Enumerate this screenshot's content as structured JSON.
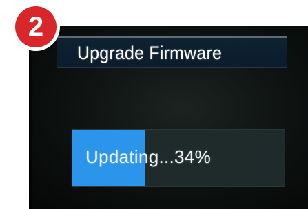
{
  "step_badge": "2",
  "dialog": {
    "title": "Upgrade Firmware"
  },
  "progress": {
    "label": "Updating...34%",
    "percent": 34,
    "fill_color": "#2a95ea"
  },
  "colors": {
    "badge": "#d8262a",
    "title_bar": "#0e2233",
    "track": "#1f2b2b"
  }
}
